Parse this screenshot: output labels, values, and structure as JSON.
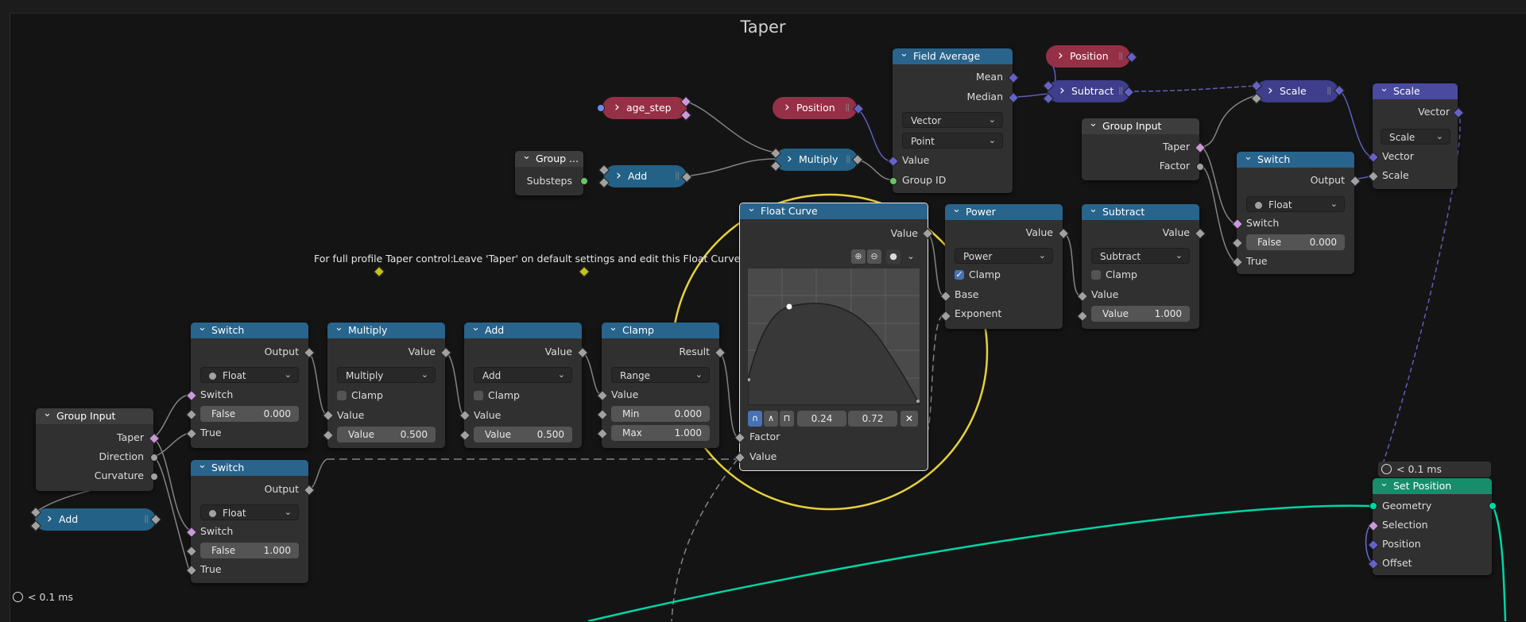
{
  "frame": {
    "title": "Taper"
  },
  "timings": {
    "bottom_left": "< 0.1 ms",
    "set_position": "< 0.1 ms"
  },
  "notes": {
    "profile": "For full profile Taper control:",
    "leave": "Leave 'Taper' on default settings and edit this Float Curve."
  },
  "pills": {
    "age_step": "age_step",
    "position1": "Position",
    "position2": "Position",
    "add_top": "Add",
    "multiply_top": "Multiply",
    "subtract_top": "Subtract",
    "scale_top": "Scale",
    "add_bottom": "Add"
  },
  "group_small": {
    "title": "Group ...",
    "substeps": "Substeps"
  },
  "field_average": {
    "title": "Field Average",
    "mean": "Mean",
    "median": "Median",
    "type": "Vector",
    "domain": "Point",
    "value": "Value",
    "group_id": "Group ID"
  },
  "group_input_right": {
    "title": "Group Input",
    "taper": "Taper",
    "factor": "Factor"
  },
  "scale_node": {
    "title": "Scale",
    "vector_out": "Vector",
    "mode": "Scale",
    "vector_in": "Vector",
    "scale": "Scale"
  },
  "switch_right": {
    "title": "Switch",
    "output": "Output",
    "type": "Float",
    "switch": "Switch",
    "false_label": "False",
    "false_value": "0.000",
    "true_label": "True"
  },
  "float_curve": {
    "title": "Float Curve",
    "value_out": "Value",
    "x": "0.24",
    "y": "0.72",
    "factor": "Factor",
    "value_in": "Value"
  },
  "power": {
    "title": "Power",
    "value_out": "Value",
    "op": "Power",
    "clamp": "Clamp",
    "base": "Base",
    "exponent": "Exponent"
  },
  "subtract_node": {
    "title": "Subtract",
    "value_out": "Value",
    "op": "Subtract",
    "clamp": "Clamp",
    "value_in": "Value",
    "field_label": "Value",
    "field_value": "1.000"
  },
  "switch1": {
    "title": "Switch",
    "output": "Output",
    "type": "Float",
    "switch": "Switch",
    "false_label": "False",
    "false_value": "0.000",
    "true_label": "True"
  },
  "switch2": {
    "title": "Switch",
    "output": "Output",
    "type": "Float",
    "switch": "Switch",
    "false_label": "False",
    "false_value": "1.000",
    "true_label": "True"
  },
  "multiply_node": {
    "title": "Multiply",
    "value_out": "Value",
    "op": "Multiply",
    "clamp": "Clamp",
    "value_in": "Value",
    "field_label": "Value",
    "field_value": "0.500"
  },
  "add_node": {
    "title": "Add",
    "value_out": "Value",
    "op": "Add",
    "clamp": "Clamp",
    "value_in": "Value",
    "field_label": "Value",
    "field_value": "0.500"
  },
  "clamp_node": {
    "title": "Clamp",
    "result": "Result",
    "mode": "Range",
    "value_in": "Value",
    "min_label": "Min",
    "min_value": "0.000",
    "max_label": "Max",
    "max_value": "1.000"
  },
  "group_input_left": {
    "title": "Group Input",
    "taper": "Taper",
    "direction": "Direction",
    "curvature": "Curvature"
  },
  "set_position": {
    "title": "Set Position",
    "geometry": "Geometry",
    "selection": "Selection",
    "position": "Position",
    "offset": "Offset"
  },
  "colors": {
    "float_header": "#28648c",
    "geometry_header": "#168e6c",
    "highlight": "#e6d03c",
    "geometry_wire": "#00d6a3"
  }
}
